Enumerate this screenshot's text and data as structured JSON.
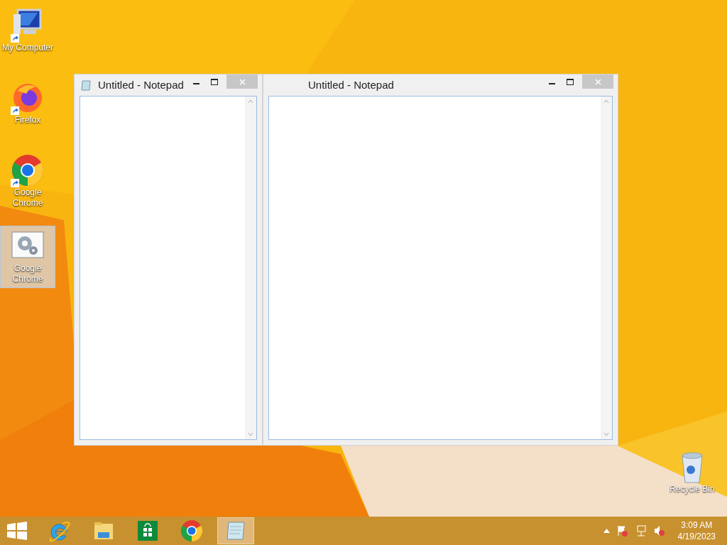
{
  "desktop_icons": [
    {
      "kind": "computer",
      "label": "My Computer",
      "shortcut": true,
      "selected": false
    },
    {
      "kind": "firefox",
      "label": "Firefox",
      "shortcut": true,
      "selected": false
    },
    {
      "kind": "chrome",
      "label": "Google Chrome",
      "shortcut": true,
      "selected": false
    },
    {
      "kind": "settings",
      "label": "Google Chrome",
      "shortcut": false,
      "selected": true
    },
    {
      "kind": "recycle",
      "label": "Recycle Bin",
      "shortcut": false,
      "selected": false
    }
  ],
  "windows": [
    {
      "title": "Untitled - Notepad",
      "show_icon": true
    },
    {
      "title": "Untitled - Notepad",
      "show_icon": false
    }
  ],
  "taskbar": {
    "apps": [
      {
        "kind": "ie",
        "selected": false
      },
      {
        "kind": "explorer",
        "selected": false
      },
      {
        "kind": "store",
        "selected": false
      },
      {
        "kind": "chrome",
        "selected": false
      },
      {
        "kind": "notepad",
        "selected": true
      }
    ],
    "clock": {
      "time": "3:09 AM",
      "date": "4/19/2023"
    }
  }
}
